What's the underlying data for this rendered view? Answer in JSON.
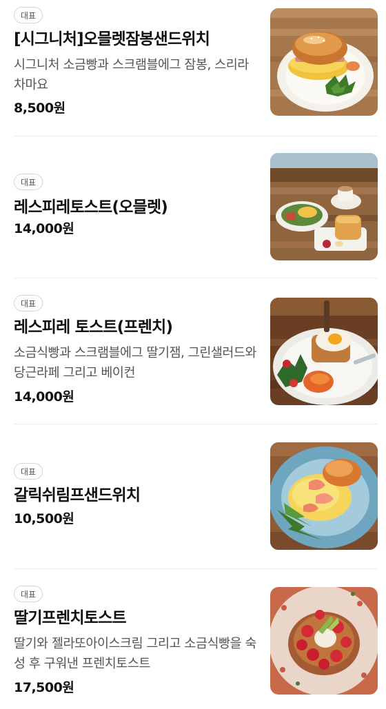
{
  "menu": {
    "items": [
      {
        "badge": "대표",
        "name": "[시그니처]오믈렛잠봉샌드위치",
        "description": "시그니처 소금빵과 스크램블에그 잠봉, 스리라차마요",
        "price": "8,500원",
        "photo": "omelette-jambon-sandwich-photo"
      },
      {
        "badge": "대표",
        "name": "레스피레토스트(오믈렛)",
        "description": "",
        "price": "14,000원",
        "photo": "respire-toast-omelette-photo"
      },
      {
        "badge": "대표",
        "name": "레스피레 토스트(프렌치)",
        "description": "소금식빵과 스크램블에그 딸기잼, 그린샐러드와 당근라페 그리고 베이컨",
        "price": "14,000원",
        "photo": "respire-toast-french-photo"
      },
      {
        "badge": "대표",
        "name": "갈릭쉬림프샌드위치",
        "description": "",
        "price": "10,500원",
        "photo": "garlic-shrimp-sandwich-photo"
      },
      {
        "badge": "대표",
        "name": "딸기프렌치토스트",
        "description": "딸기와 젤라또아이스크림 그리고 소금식빵을 숙성 후 구워낸 프렌치토스트",
        "price": "17,500원",
        "photo": "strawberry-french-toast-photo"
      }
    ]
  }
}
